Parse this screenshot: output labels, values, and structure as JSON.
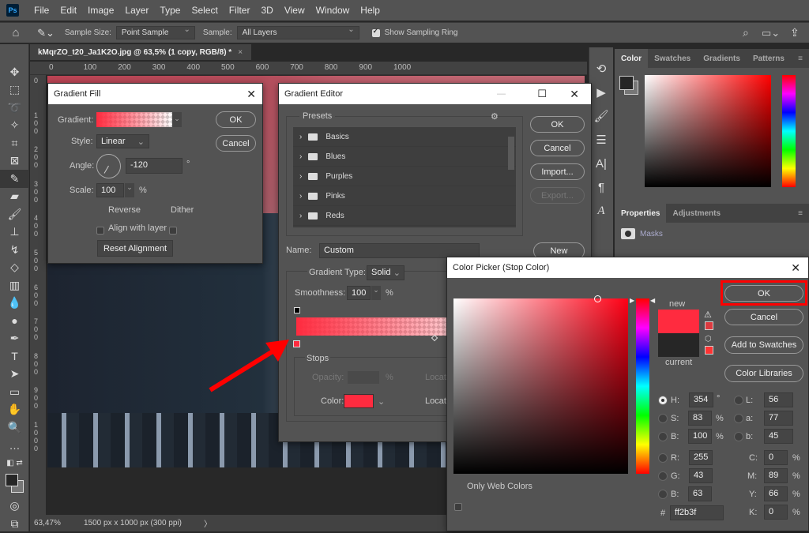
{
  "menubar": {
    "logo": "Ps",
    "items": [
      "File",
      "Edit",
      "Image",
      "Layer",
      "Type",
      "Select",
      "Filter",
      "3D",
      "View",
      "Window",
      "Help"
    ]
  },
  "options": {
    "sample_size_label": "Sample Size:",
    "sample_size_value": "Point Sample",
    "sample_label": "Sample:",
    "sample_value": "All Layers",
    "show_ring_label": "Show Sampling Ring"
  },
  "document": {
    "tab_title": "kMqrZO_t20_Ja1K2O.jpg @ 63,5% (1 copy, RGB/8) *",
    "ruler_top": [
      "0",
      "100",
      "200",
      "300",
      "400",
      "500",
      "600",
      "700",
      "800",
      "900",
      "1000"
    ],
    "ruler_left": [
      "0",
      "100",
      "200",
      "300",
      "400",
      "500",
      "600",
      "700",
      "800",
      "900",
      "1000"
    ],
    "zoom": "63,47%",
    "doc_info": "1500 px x 1000 px (300 ppi)"
  },
  "color_panel": {
    "tabs": [
      "Color",
      "Swatches",
      "Gradients",
      "Patterns"
    ]
  },
  "properties_panel": {
    "tabs": [
      "Properties",
      "Adjustments"
    ],
    "masks_label": "Masks"
  },
  "gradient_fill": {
    "title": "Gradient Fill",
    "gradient_label": "Gradient:",
    "style_label": "Style:",
    "style_value": "Linear",
    "angle_label": "Angle:",
    "angle_value": "-120",
    "angle_unit": "°",
    "scale_label": "Scale:",
    "scale_value": "100",
    "scale_unit": "%",
    "reverse_label": "Reverse",
    "dither_label": "Dither",
    "align_label": "Align with layer",
    "reset_label": "Reset Alignment",
    "ok": "OK",
    "cancel": "Cancel"
  },
  "gradient_editor": {
    "title": "Gradient Editor",
    "presets_label": "Presets",
    "presets": [
      "Basics",
      "Blues",
      "Purples",
      "Pinks",
      "Reds"
    ],
    "ok": "OK",
    "cancel": "Cancel",
    "import": "Import...",
    "export": "Export...",
    "name_label": "Name:",
    "name_value": "Custom",
    "new": "New",
    "type_label": "Gradient Type:",
    "type_value": "Solid",
    "smoothness_label": "Smoothness:",
    "smoothness_value": "100",
    "smoothness_unit": "%",
    "stops_label": "Stops",
    "opacity_label": "Opacity:",
    "opacity_unit": "%",
    "location_label": "Locat",
    "color_label": "Color:"
  },
  "color_picker": {
    "title": "Color Picker (Stop Color)",
    "ok": "OK",
    "cancel": "Cancel",
    "add_swatches": "Add to Swatches",
    "color_libraries": "Color Libraries",
    "new_label": "new",
    "current_label": "current",
    "only_web": "Only Web Colors",
    "hsb": [
      {
        "label": "H:",
        "value": "354",
        "unit": "°"
      },
      {
        "label": "S:",
        "value": "83",
        "unit": "%"
      },
      {
        "label": "B:",
        "value": "100",
        "unit": "%"
      }
    ],
    "rgb": [
      {
        "label": "R:",
        "value": "255"
      },
      {
        "label": "G:",
        "value": "43"
      },
      {
        "label": "B:",
        "value": "63"
      }
    ],
    "lab": [
      {
        "label": "L:",
        "value": "56"
      },
      {
        "label": "a:",
        "value": "77"
      },
      {
        "label": "b:",
        "value": "45"
      }
    ],
    "cmyk": [
      {
        "label": "C:",
        "value": "0",
        "unit": "%"
      },
      {
        "label": "M:",
        "value": "89",
        "unit": "%"
      },
      {
        "label": "Y:",
        "value": "66",
        "unit": "%"
      },
      {
        "label": "K:",
        "value": "0",
        "unit": "%"
      }
    ],
    "hex_label": "#",
    "hex": "ff2b3f",
    "new_color": "#ff2b3f",
    "current_color": "#262626"
  }
}
